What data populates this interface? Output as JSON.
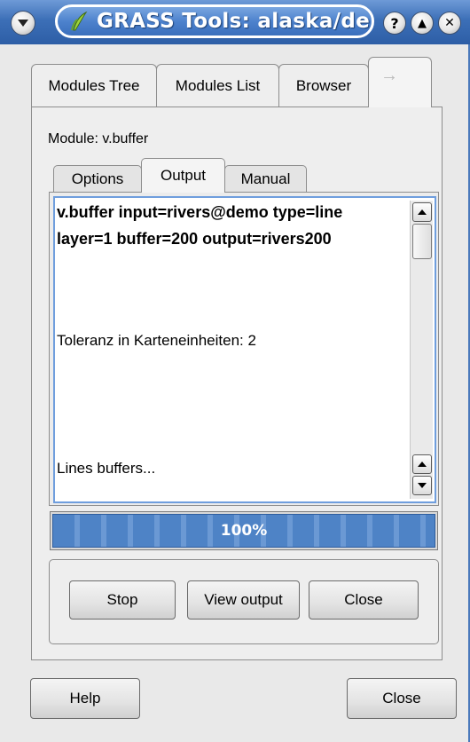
{
  "window": {
    "title": "GRASS Tools: alaska/demo",
    "buttons": {
      "help": "?",
      "shade": "▲",
      "close": "✕"
    }
  },
  "outer_tabs": [
    {
      "label": "Modules Tree"
    },
    {
      "label": "Modules List"
    },
    {
      "label": "Browser"
    },
    {
      "label": "→",
      "icon": "arrow-right-icon"
    }
  ],
  "module": {
    "label": "Module: v.buffer"
  },
  "inner_tabs": [
    {
      "label": "Options"
    },
    {
      "label": "Output"
    },
    {
      "label": "Manual"
    }
  ],
  "output": {
    "command_line1": "v.buffer input=rivers@demo type=line",
    "command_line2": "layer=1 buffer=200 output=rivers200",
    "message1": "Toleranz in Karteneinheiten: 2",
    "message2": "Lines buffers..."
  },
  "progress": {
    "value": 100,
    "text": "100%"
  },
  "actions": {
    "stop": "Stop",
    "view_output": "View output",
    "close": "Close"
  },
  "footer": {
    "help": "Help",
    "close": "Close"
  },
  "colors": {
    "titlebar": "#3c6fb7",
    "progress": "#4e83c6",
    "selection_border": "#6f9edd"
  }
}
